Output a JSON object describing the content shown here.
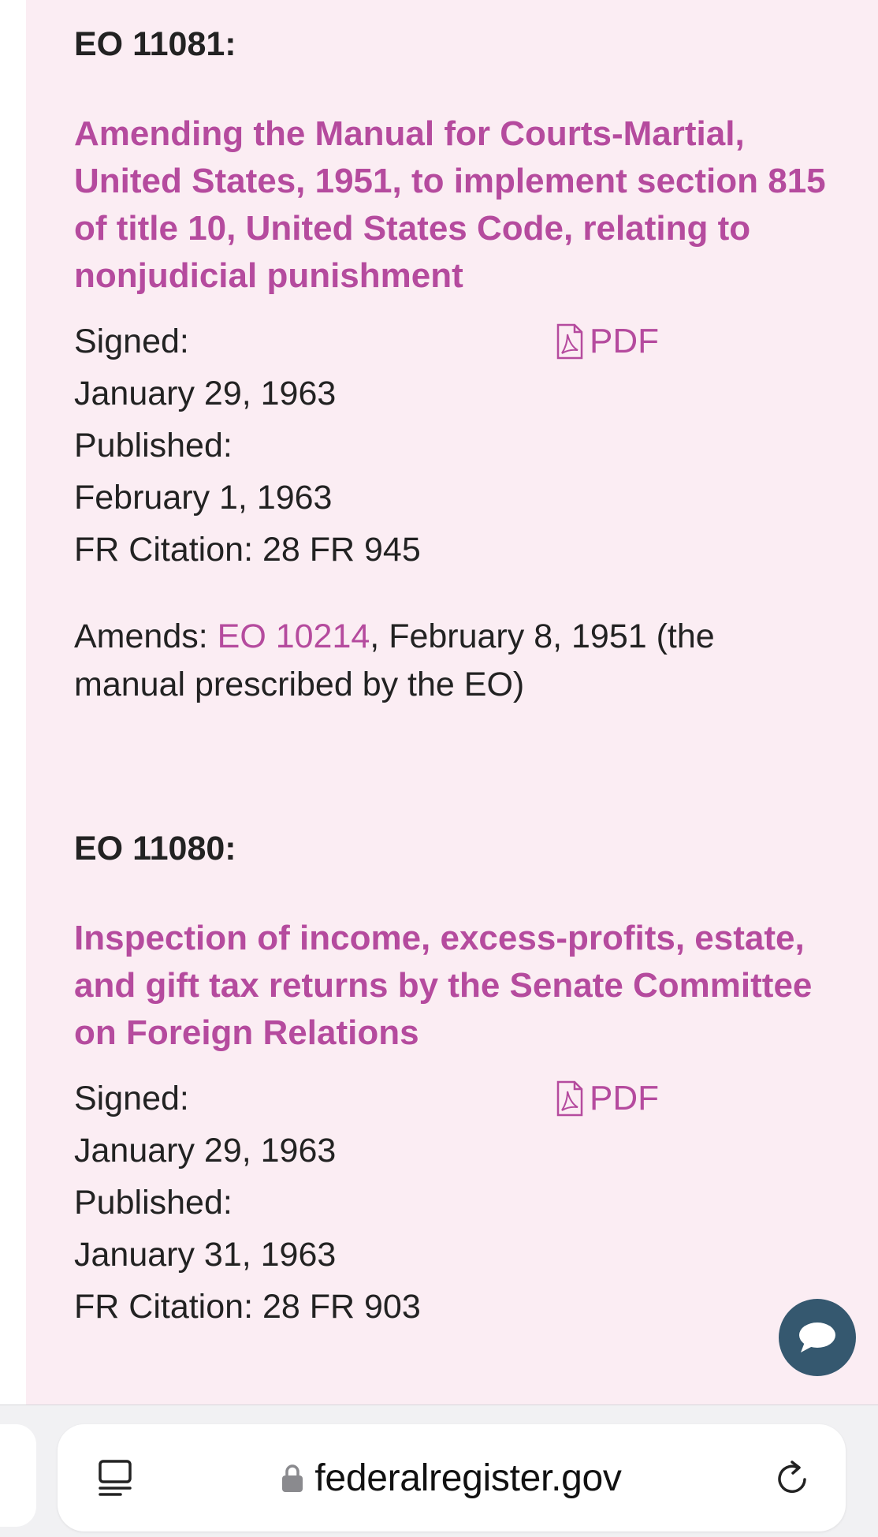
{
  "entries": [
    {
      "eo_label": "EO 11081:",
      "title": "Amending the Manual for Courts-Martial, United States, 1951, to implement section 815 of title 10, United States Code, relating to nonjudicial punishment",
      "signed_label": "Signed:",
      "signed_date": "January 29, 1963",
      "published_label": "Published:",
      "published_date": "February 1, 1963",
      "citation": "FR Citation: 28 FR 945",
      "pdf_label": "PDF",
      "amends_label": "Amends: ",
      "amends_link": "EO 10214",
      "amends_rest": ", February 8, 1951 (the manual prescribed by the EO)"
    },
    {
      "eo_label": "EO 11080:",
      "title": "Inspection of income, excess-profits, estate, and gift tax returns by the Senate Committee on Foreign Relations",
      "signed_label": "Signed:",
      "signed_date": "January 29, 1963",
      "published_label": "Published:",
      "published_date": "January 31, 1963",
      "citation": "FR Citation: 28 FR 903",
      "pdf_label": "PDF"
    }
  ],
  "browser": {
    "url": "federalregister.gov",
    "icons": [
      "tabs-icon",
      "lock-icon",
      "reload-icon"
    ]
  },
  "chat": {
    "icon": "chat-bubble-icon"
  },
  "colors": {
    "panel_bg": "#fbedf3",
    "link": "#b54b9e",
    "text": "#222222",
    "chat_button": "#35586f",
    "toolbar_bg": "#f1f1f3"
  }
}
